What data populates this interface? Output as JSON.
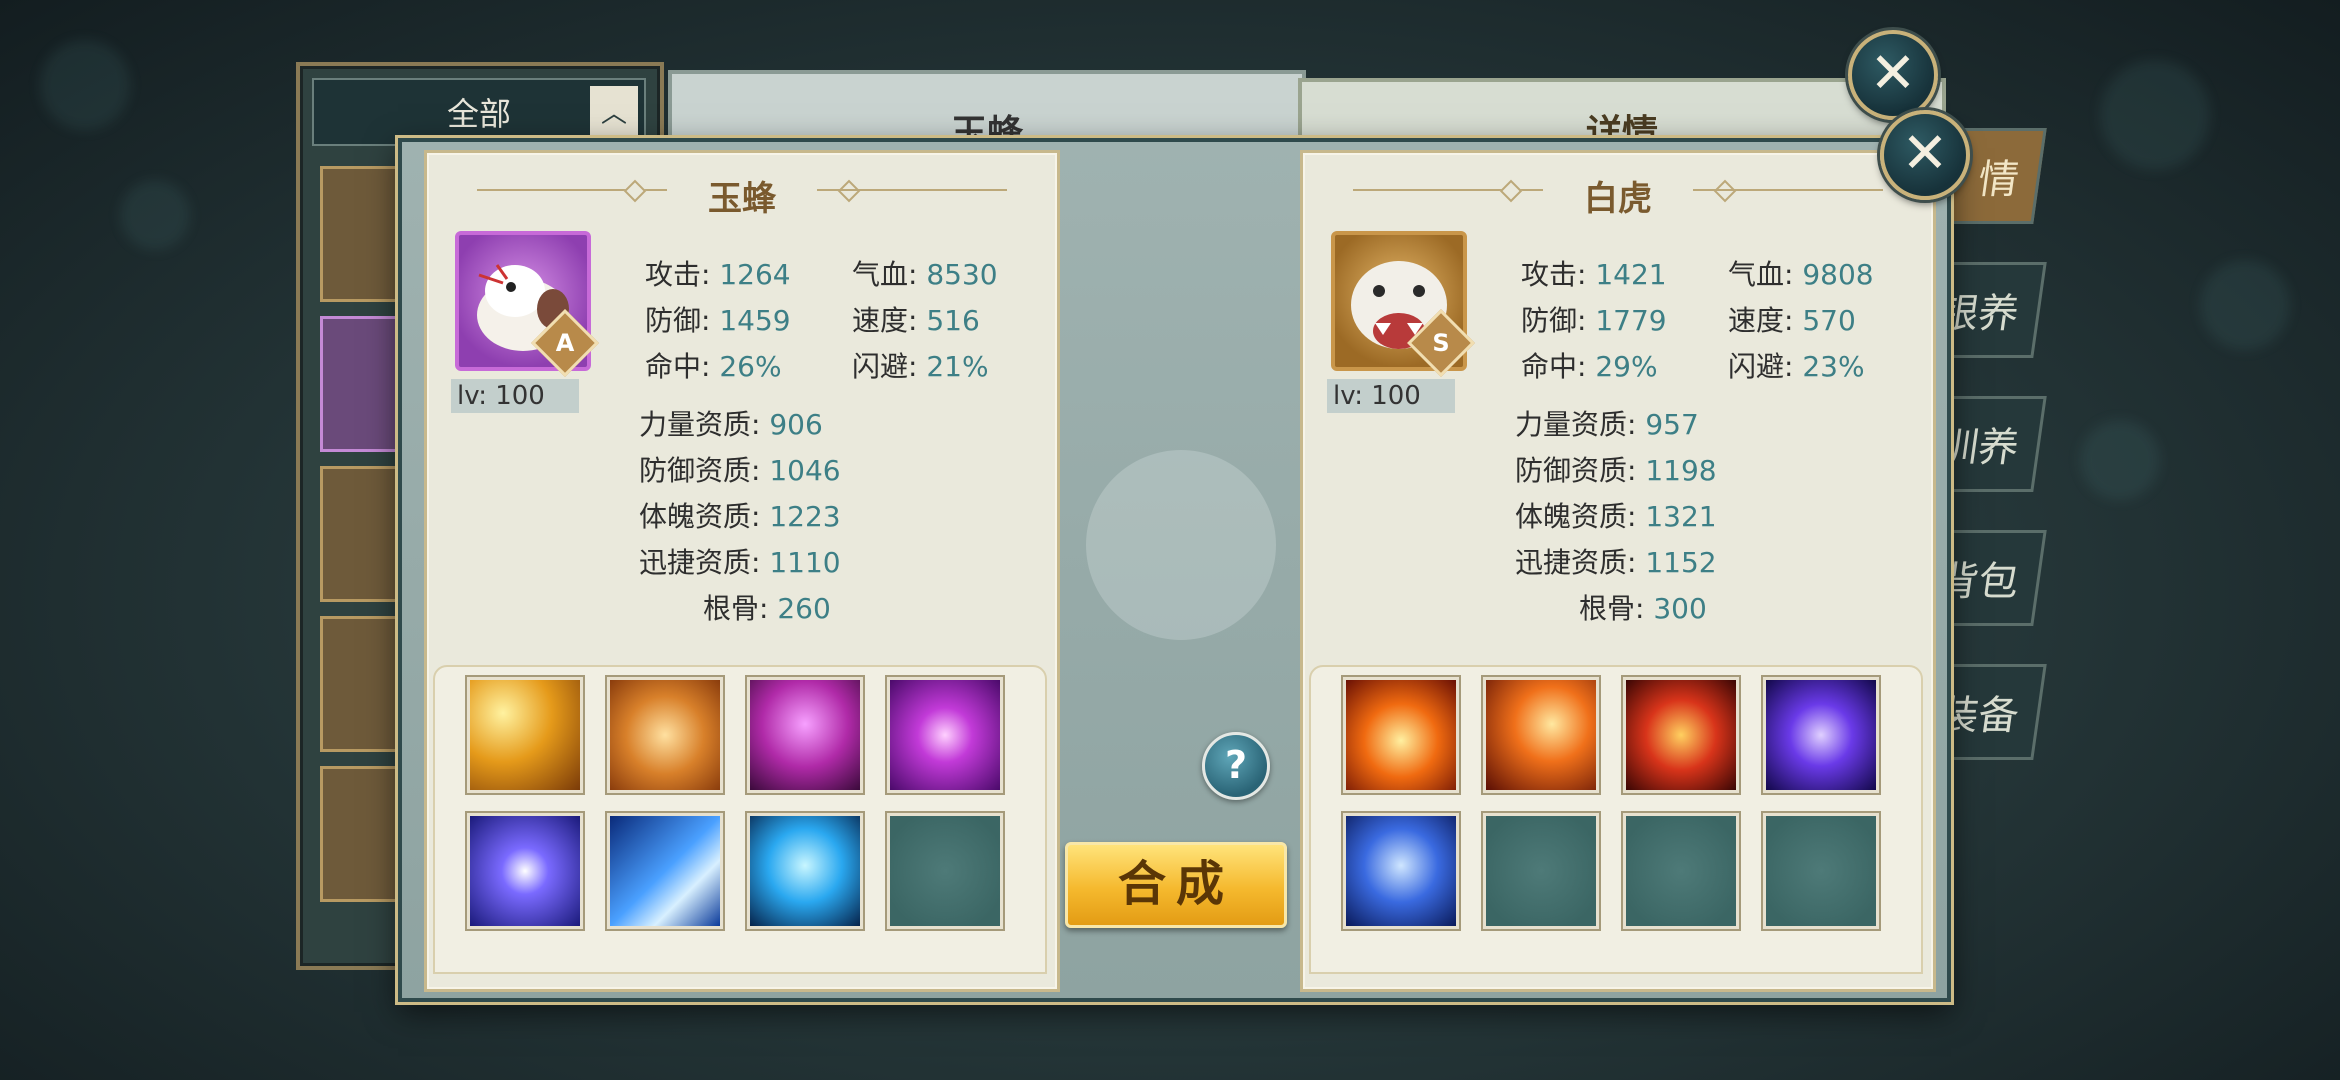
{
  "background": {
    "filter_label": "全部",
    "center_title": "玉蜂",
    "right_title": "详情",
    "side_tabs": [
      "情",
      "银养",
      "训养",
      "背包",
      "装备"
    ]
  },
  "dialog": {
    "merge_button": "合成",
    "help_icon_glyph": "?",
    "close_icon_glyph": "✕",
    "left_pet": {
      "name": "玉蜂",
      "grade": "A",
      "level": "lv: 100",
      "stats": {
        "attack_k": "攻击:",
        "attack_v": "1264",
        "hp_k": "气血:",
        "hp_v": "8530",
        "defense_k": "防御:",
        "defense_v": "1459",
        "speed_k": "速度:",
        "speed_v": "516",
        "hit_k": "命中:",
        "hit_v": "26%",
        "dodge_k": "闪避:",
        "dodge_v": "21%",
        "str_apt_k": "力量资质:",
        "str_apt_v": "906",
        "def_apt_k": "防御资质:",
        "def_apt_v": "1046",
        "con_apt_k": "体魄资质:",
        "con_apt_v": "1223",
        "agi_apt_k": "迅捷资质:",
        "agi_apt_v": "1110",
        "bone_k": "根骨:",
        "bone_v": "260"
      },
      "skills": [
        "golden-slash-icon",
        "golden-lion-icon",
        "purple-shield-icon",
        "purple-orb-icon",
        "blue-orb-icon",
        "blue-chevron-icon",
        "blue-heart-icon",
        "empty-slot-icon"
      ]
    },
    "right_pet": {
      "name": "白虎",
      "grade": "S",
      "level": "lv: 100",
      "stats": {
        "attack_k": "攻击:",
        "attack_v": "1421",
        "hp_k": "气血:",
        "hp_v": "9808",
        "defense_k": "防御:",
        "defense_v": "1779",
        "speed_k": "速度:",
        "speed_v": "570",
        "hit_k": "命中:",
        "hit_v": "29%",
        "dodge_k": "闪避:",
        "dodge_v": "23%",
        "str_apt_k": "力量资质:",
        "str_apt_v": "957",
        "def_apt_k": "防御资质:",
        "def_apt_v": "1198",
        "con_apt_k": "体魄资质:",
        "con_apt_v": "1321",
        "agi_apt_k": "迅捷资质:",
        "agi_apt_v": "1152",
        "bone_k": "根骨:",
        "bone_v": "300"
      },
      "skills": [
        "fire-burst-icon",
        "fire-phoenix-icon",
        "fire-orb-icon",
        "purple-vortex-icon",
        "blue-shield-icon",
        "empty-slot-icon",
        "empty-slot-icon",
        "empty-slot-icon"
      ]
    }
  }
}
